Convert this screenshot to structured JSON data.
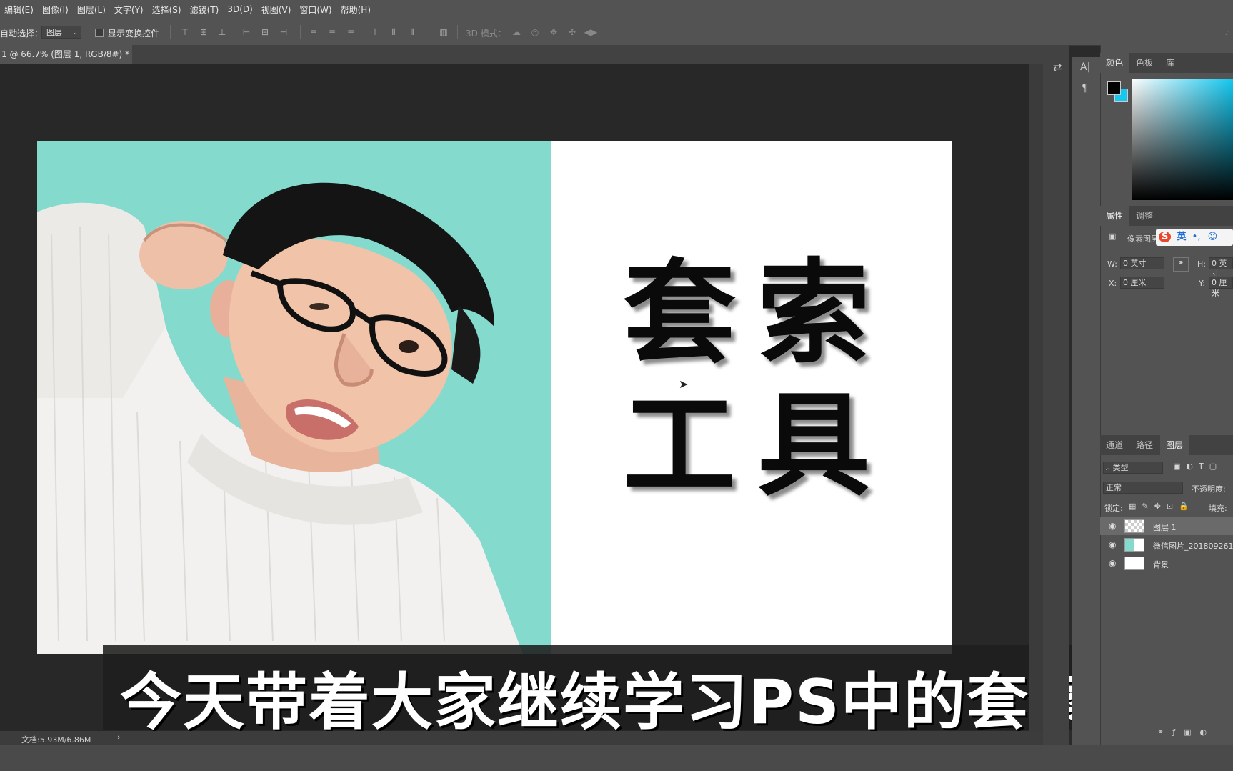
{
  "menubar": {
    "items": [
      "编辑(E)",
      "图像(I)",
      "图层(L)",
      "文字(Y)",
      "选择(S)",
      "滤镜(T)",
      "3D(D)",
      "视图(V)",
      "窗口(W)",
      "帮助(H)"
    ]
  },
  "options": {
    "auto_select_label": "自动选择：",
    "auto_select_value": "图层",
    "show_transform_label": "显示变换控件",
    "mode_3d_label": "3D 模式："
  },
  "document": {
    "tab_title": "1 @ 66.7% (图层 1, RGB/8#) *",
    "close_glyph": "×",
    "status_text": "文档:5.93M/6.86M"
  },
  "canvas": {
    "text_line1": "套索",
    "text_line2": "工具"
  },
  "subtitle": "今天带着大家继续学习PS中的套索工具",
  "panels": {
    "color_tabs": [
      "颜色",
      "色板",
      "库"
    ],
    "props_tabs": [
      "属性",
      "调整"
    ],
    "props_kind": "像素图层",
    "ime": {
      "brand": "S",
      "lang": "英",
      "punct": "•,"
    },
    "w_label": "W:",
    "w_value": "0 英寸",
    "h_label": "H:",
    "h_value": "0 英寸",
    "x_label": "X:",
    "x_value": "0 厘米",
    "y_label": "Y:",
    "y_value": "0 厘米",
    "layers_tabs": [
      "通道",
      "路径",
      "图层"
    ],
    "filter_kind": "类型",
    "blend_mode": "正常",
    "opacity_label": "不透明度:",
    "lock_label": "锁定:",
    "fill_label": "填充:",
    "layers": [
      {
        "name": "图层 1",
        "selected": true
      },
      {
        "name": "微信图片_201809261",
        "selected": false
      },
      {
        "name": "背景",
        "selected": false
      }
    ]
  },
  "colors": {
    "teal": "#84dacd",
    "accent_cyan": "#14c8f0"
  }
}
